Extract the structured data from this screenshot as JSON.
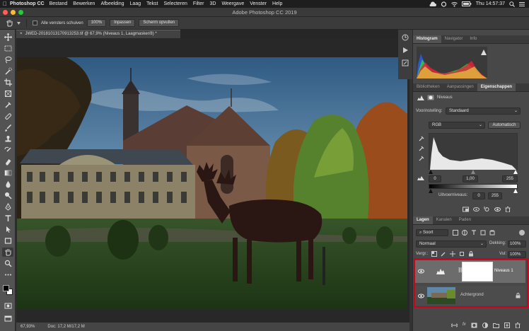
{
  "menubar": {
    "app_name": "Photoshop CC",
    "items": [
      "Bestand",
      "Bewerken",
      "Afbeelding",
      "Laag",
      "Tekst",
      "Selecteren",
      "Filter",
      "3D",
      "Weergave",
      "Venster",
      "Help"
    ],
    "clock": "Thu 14:57:37"
  },
  "window": {
    "title": "Adobe Photoshop CC 2019"
  },
  "options_bar": {
    "checkbox_label": "Alle vensters schuiven",
    "zoom_button": "100%",
    "fit_button": "Inpassen",
    "fill_button": "Scherm opvullen"
  },
  "document": {
    "tab_title": "JWED-20181013170913253.tif @ 67,9% (Niveaus 1, Laagmasker/8) *"
  },
  "status_bar": {
    "zoom": "67,93%",
    "doc_info": "Doc: 17,2 M/17,2 M"
  },
  "panels": {
    "top_tabs": [
      "Histogram",
      "Navigator",
      "Info"
    ],
    "mid_tabs": [
      "Bibliotheken",
      "Aanpassingen",
      "Eigenschappen"
    ],
    "properties": {
      "header": "Niveaus",
      "preset_label": "Voorinstelling:",
      "preset_value": "Standaard",
      "channel_value": "RGB",
      "auto_button": "Automatisch",
      "input_black": "0",
      "input_gamma": "1,00",
      "input_white": "255",
      "output_label": "Uitvoerniveaus:",
      "output_black": "0",
      "output_white": "255"
    },
    "layers_tabs": [
      "Lagen",
      "Kanalen",
      "Paden"
    ],
    "layers": {
      "filter_value": "Soort",
      "blend_mode": "Normaal",
      "opacity_label": "Dekking:",
      "opacity_value": "100%",
      "lock_label": "Vergr.:",
      "fill_label": "Vul:",
      "fill_value": "100%",
      "items": [
        {
          "name": "Niveaus 1"
        },
        {
          "name": "Achtergrond"
        }
      ]
    }
  },
  "colors": {
    "highlight": "#d0021b",
    "accent": "#2d8ceb"
  }
}
